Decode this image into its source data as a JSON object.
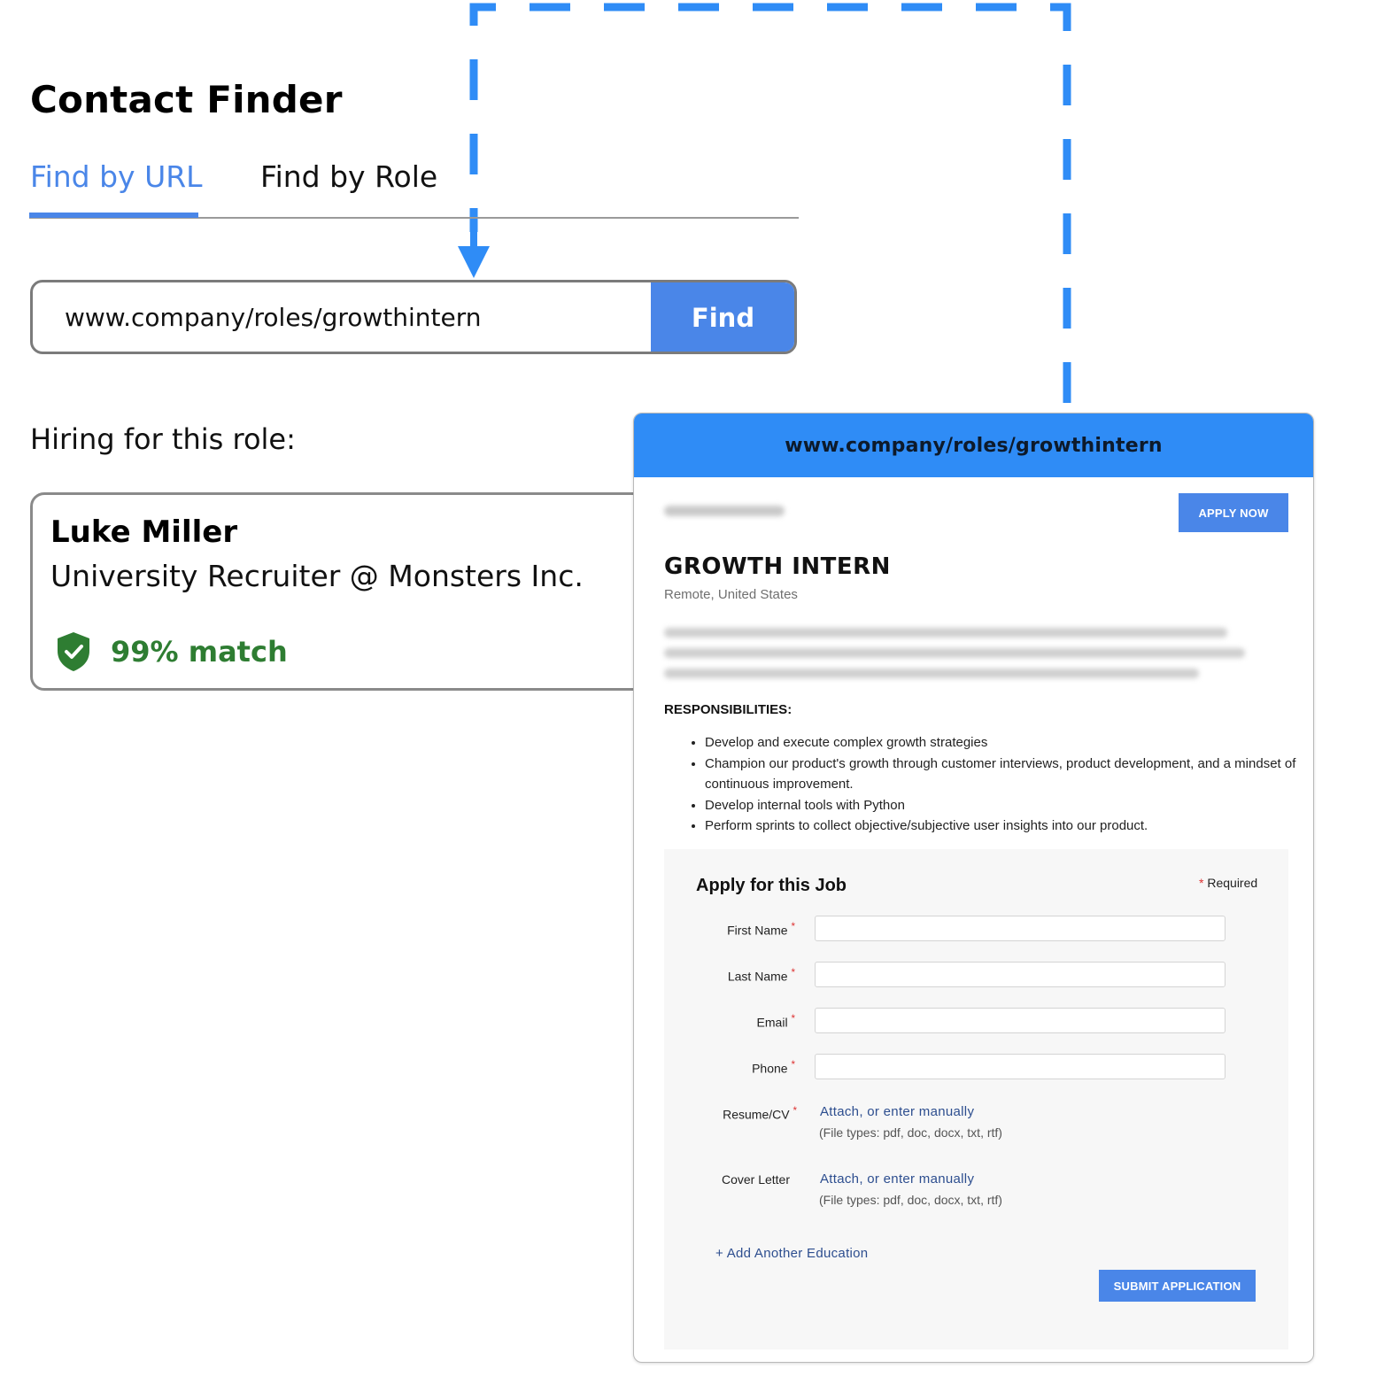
{
  "finder": {
    "title": "Contact Finder",
    "tabs": [
      {
        "label": "Find by URL",
        "active": true
      },
      {
        "label": "Find by Role",
        "active": false
      }
    ],
    "search": {
      "value": "www.company/roles/growthintern",
      "button_label": "Find"
    },
    "hiring_label": "Hiring for this role:",
    "contact": {
      "name": "Luke Miller",
      "role": "University Recruiter @ Monsters Inc.",
      "match": "99% match"
    }
  },
  "browser": {
    "url": "www.company/roles/growthintern",
    "apply_now_label": "APPLY NOW",
    "job_title": "GROWTH INTERN",
    "location": "Remote, United States",
    "responsibilities_heading": "RESPONSIBILITIES:",
    "responsibilities": [
      "Develop and execute complex growth strategies",
      "Champion our product's growth through customer interviews, product development, and a mindset of continuous improvement.",
      "Develop internal tools with Python",
      "Perform sprints to collect objective/subjective user insights into our product."
    ],
    "form": {
      "title": "Apply for this Job",
      "required_note": "Required",
      "required_marker": "*",
      "fields": [
        {
          "label": "First Name",
          "value": ""
        },
        {
          "label": "Last Name",
          "value": ""
        },
        {
          "label": "Email",
          "value": ""
        },
        {
          "label": "Phone",
          "value": ""
        }
      ],
      "resume": {
        "label": "Resume/CV",
        "attach": "Attach,",
        "manual": "or enter manually",
        "hint": "(File types: pdf, doc, docx, txt, rtf)"
      },
      "cover_letter": {
        "label": "Cover Letter",
        "attach": "Attach,",
        "manual": "or enter manually",
        "hint": "(File types: pdf, doc, docx, txt, rtf)"
      },
      "add_education": "+ Add Another Education",
      "submit_label": "SUBMIT APPLICATION"
    }
  },
  "colors": {
    "accent": "#4a86e8",
    "browser_bar": "#2f8cf6",
    "connector": "#2f8cf6",
    "match_green": "#2e7d32",
    "required_red": "#dd3333"
  },
  "icons": {
    "shield": "shield-check-icon",
    "arrow": "arrow-down-icon"
  }
}
